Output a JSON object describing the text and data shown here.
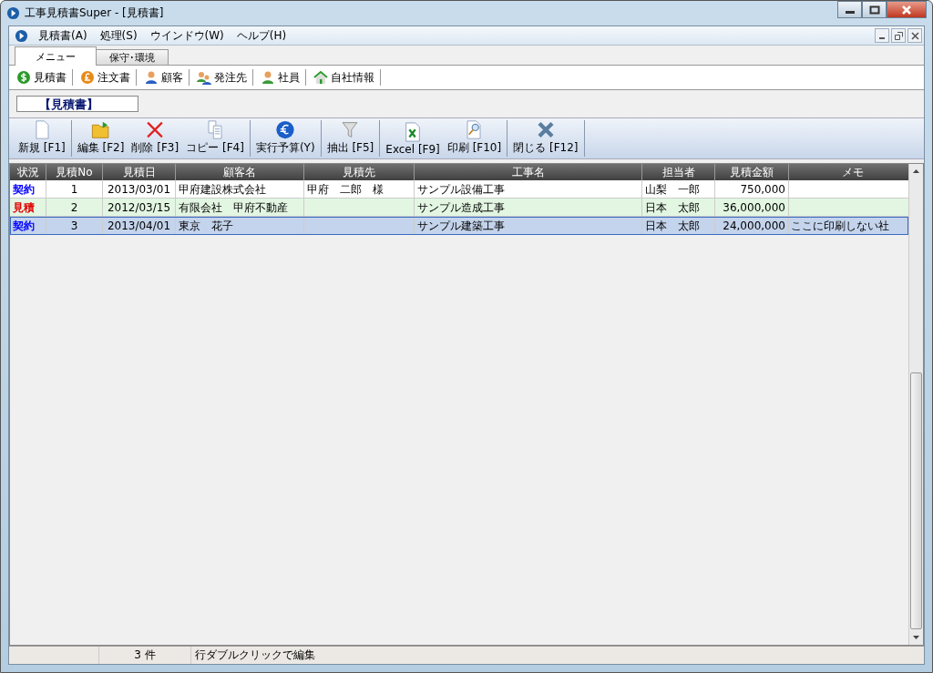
{
  "window": {
    "title": "工事見積書Super - [見積書]"
  },
  "menu": [
    "見積書(A)",
    "処理(S)",
    "ウインドウ(W)",
    "ヘルプ(H)"
  ],
  "tabs": [
    {
      "label": "メニュー",
      "selected": true
    },
    {
      "label": "保守･環境",
      "selected": false
    }
  ],
  "quick_links": [
    {
      "label": "見積書",
      "kind": "dollar"
    },
    {
      "label": "注文書",
      "kind": "pound"
    },
    {
      "label": "顧客",
      "kind": "person"
    },
    {
      "label": "発注先",
      "kind": "people"
    },
    {
      "label": "社員",
      "kind": "staff"
    },
    {
      "label": "自社情報",
      "kind": "house"
    }
  ],
  "section_title": "【見積書】",
  "toolbar": [
    {
      "label": "新規 [F1]",
      "kind": "new"
    },
    {
      "label": "編集 [F2]",
      "kind": "edit"
    },
    {
      "label": "削除 [F3]",
      "kind": "delete"
    },
    {
      "label": "コピー [F4]",
      "kind": "copy"
    },
    {
      "label": "実行予算(Y)",
      "kind": "euro"
    },
    {
      "label": "抽出 [F5]",
      "kind": "filter"
    },
    {
      "label": "Excel [F9]",
      "kind": "excel"
    },
    {
      "label": "印刷 [F10]",
      "kind": "print"
    },
    {
      "label": "閉じる [F12]",
      "kind": "close"
    }
  ],
  "table": {
    "columns": [
      "状況",
      "見積No",
      "見積日",
      "顧客名",
      "見積先",
      "工事名",
      "担当者",
      "見積金額",
      "メモ"
    ],
    "rows": [
      {
        "selected": false,
        "color": "#0000ff",
        "cells": [
          "契約",
          "1",
          "2013/03/01",
          "甲府建設株式会社",
          "甲府　二郎　様",
          "サンプル設備工事",
          "山梨　一郎",
          "750,000",
          ""
        ]
      },
      {
        "selected": false,
        "color": "#e00000",
        "cells": [
          "見積",
          "2",
          "2012/03/15",
          "有限会社　甲府不動産",
          "",
          "サンプル造成工事",
          "日本　太郎",
          "36,000,000",
          ""
        ]
      },
      {
        "selected": true,
        "color": "#0000ff",
        "cells": [
          "契約",
          "3",
          "2013/04/01",
          "東京　花子",
          "",
          "サンプル建築工事",
          "日本　太郎",
          "24,000,000",
          "ここに印刷しない社"
        ]
      }
    ]
  },
  "status_bar": {
    "count": "3 件",
    "hint": "行ダブルクリックで編集"
  }
}
